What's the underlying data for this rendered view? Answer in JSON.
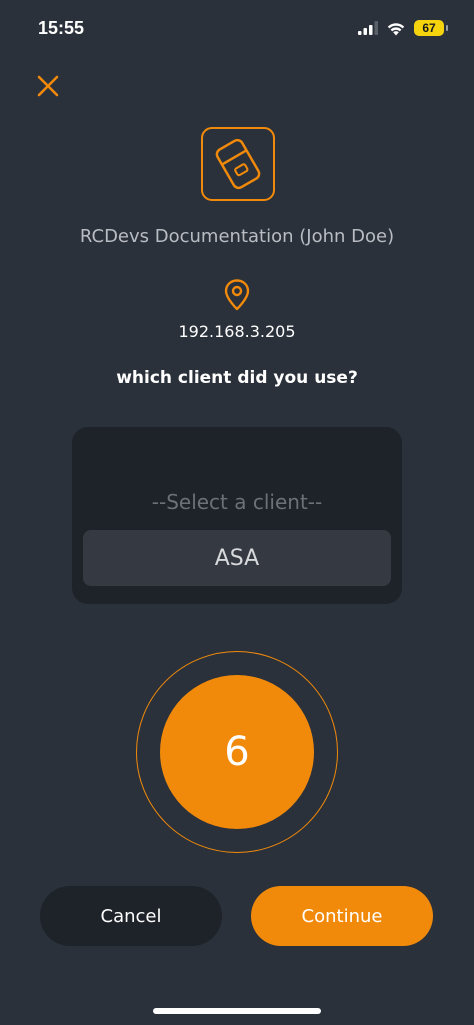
{
  "status_bar": {
    "time": "15:55",
    "battery": "67"
  },
  "app": {
    "name": "RCDevs Documentation (John Doe)",
    "ip_address": "192.168.3.205"
  },
  "question": "which client did you use?",
  "picker": {
    "placeholder_option": "--Select a client--",
    "selected_option": "ASA"
  },
  "countdown": {
    "value": "6"
  },
  "buttons": {
    "cancel_label": "Cancel",
    "continue_label": "Continue"
  },
  "colors": {
    "background": "#2b313a",
    "accent": "#f18a0b",
    "panel": "#1e232a"
  }
}
